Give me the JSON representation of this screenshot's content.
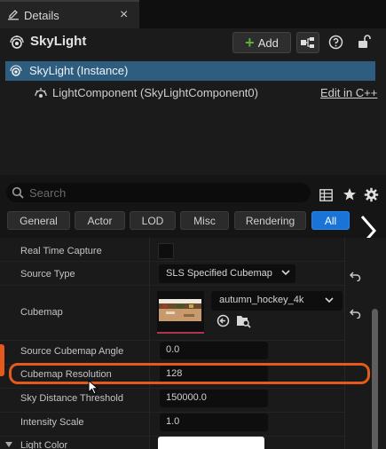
{
  "tab": {
    "title": "Details",
    "close_glyph": "×"
  },
  "header": {
    "actor_name": "SkyLight",
    "add_label": "Add",
    "add_glyph": "+"
  },
  "tree": {
    "selected_label": "SkyLight (Instance)",
    "child_label": "LightComponent (SkyLightComponent0)",
    "edit_link": "Edit in C++"
  },
  "search": {
    "placeholder": "Search",
    "value": ""
  },
  "categories": [
    "General",
    "Actor",
    "LOD",
    "Misc",
    "Rendering",
    "All"
  ],
  "active_category": "All",
  "properties": {
    "real_time_capture": {
      "label": "Real Time Capture",
      "checked": false
    },
    "source_type": {
      "label": "Source Type",
      "value": "SLS Specified Cubemap"
    },
    "cubemap": {
      "label": "Cubemap",
      "asset": "autumn_hockey_4k"
    },
    "source_cubemap_angle": {
      "label": "Source Cubemap Angle",
      "value": "0.0"
    },
    "cubemap_resolution": {
      "label": "Cubemap Resolution",
      "value": "128"
    },
    "sky_distance_threshold": {
      "label": "Sky Distance Threshold",
      "value": "150000.0"
    },
    "intensity_scale": {
      "label": "Intensity Scale",
      "value": "1.0"
    },
    "light_color": {
      "label": "Light Color",
      "value_color": "#ffffff"
    }
  },
  "colors": {
    "accent": "#1a74d8",
    "selection": "#2f5d7f",
    "annotation": "#e35a1b",
    "add_plus": "#59b03b"
  }
}
